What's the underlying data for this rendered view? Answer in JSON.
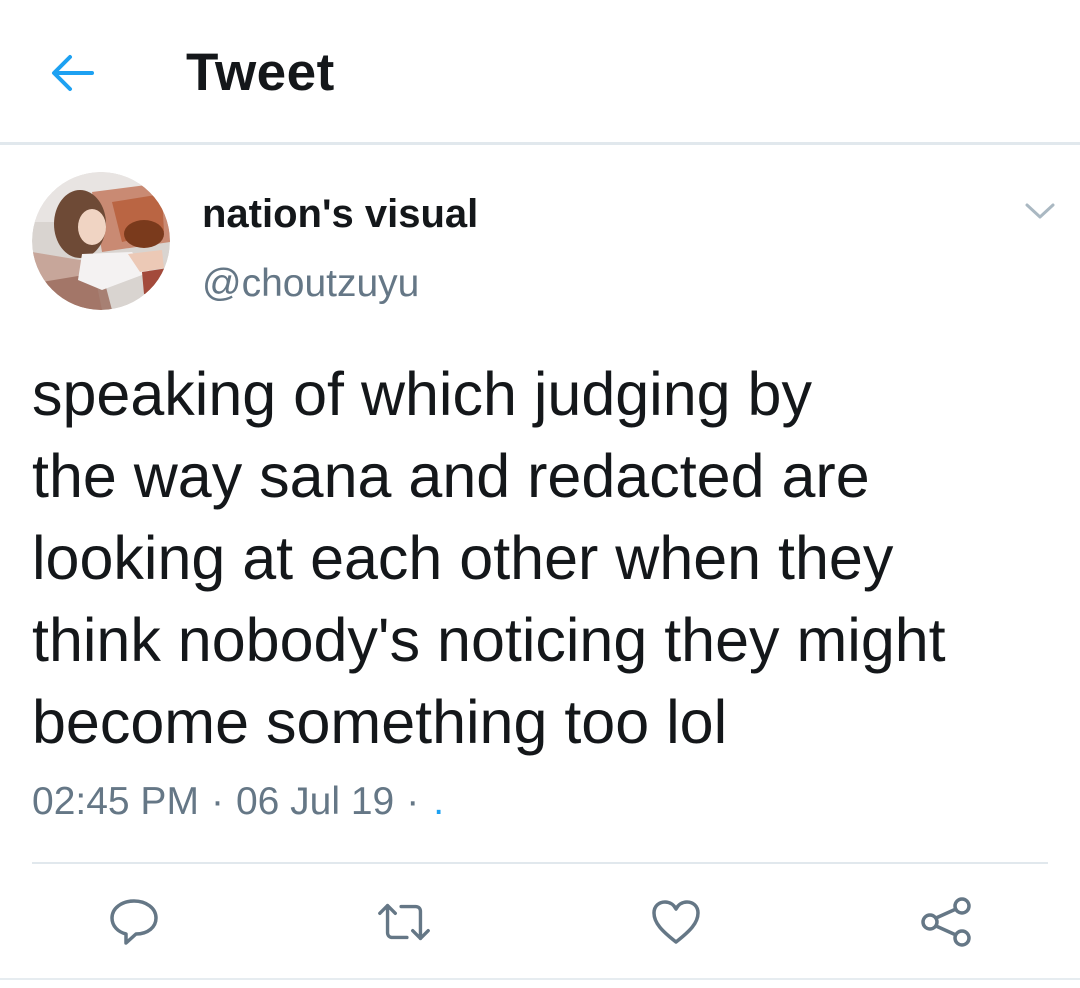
{
  "header": {
    "title": "Tweet",
    "back_icon": "arrow-left-icon",
    "accent_color": "#1da1f2"
  },
  "tweet": {
    "author": {
      "display_name": "nation's visual",
      "handle": "@choutzuyu"
    },
    "text": "speaking of which judging by\nthe way sana and redacted are\nlooking at each other when they\nthink nobody's noticing they might\nbecome something too lol",
    "time": "02:45 PM",
    "date": "06 Jul 19",
    "separator": "·",
    "source": "."
  },
  "actions": [
    {
      "name": "reply",
      "icon": "reply-icon"
    },
    {
      "name": "retweet",
      "icon": "retweet-icon"
    },
    {
      "name": "like",
      "icon": "heart-icon"
    },
    {
      "name": "share",
      "icon": "share-icon"
    }
  ],
  "colors": {
    "text_primary": "#14171a",
    "text_secondary": "#657786",
    "divider": "#e1e8ed"
  }
}
